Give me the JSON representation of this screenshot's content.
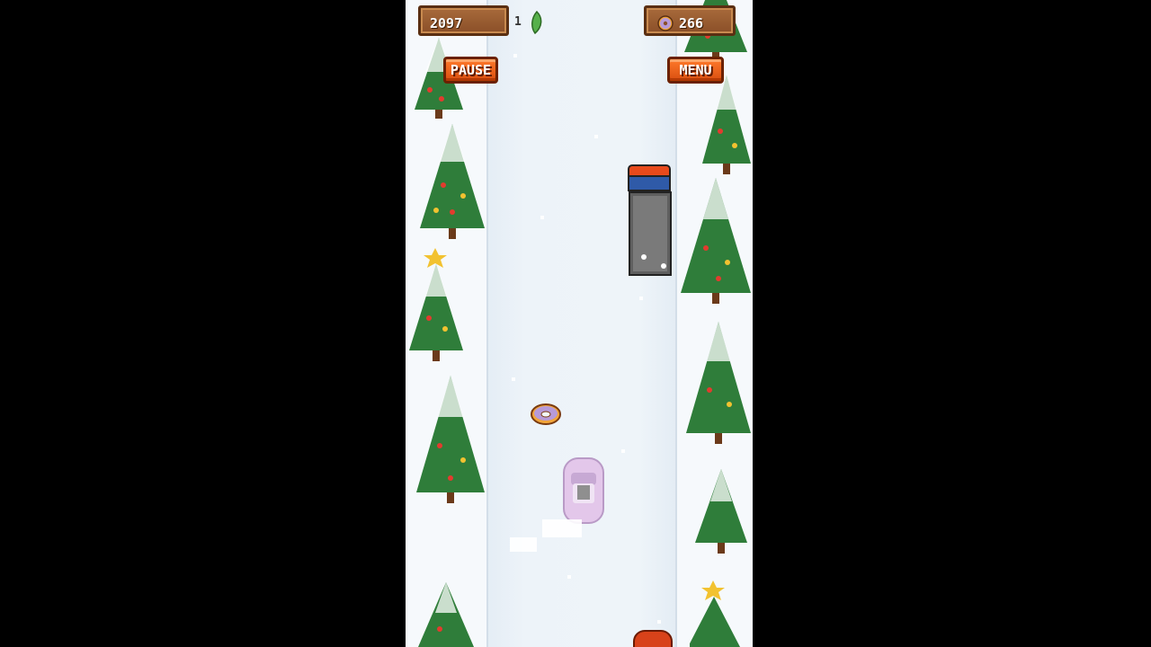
{
  "hud": {
    "score": "2097",
    "boost_count": "1",
    "donut_total": "266",
    "pause_label": "PAUSE",
    "menu_label": "MENU"
  },
  "colors": {
    "background": "#000000",
    "snow": "#f2f7fb",
    "road": "#eaf1f8",
    "button_orange": "#e85f19",
    "plank_brown": "#8a4f28",
    "tree_green": "#2f7d3a",
    "player_car": "#e3c7ea",
    "truck_cab": "#2f5aa8",
    "truck_trailer": "#5f5f5f"
  },
  "icons": [
    "leaf-icon",
    "donut-coin-icon"
  ]
}
